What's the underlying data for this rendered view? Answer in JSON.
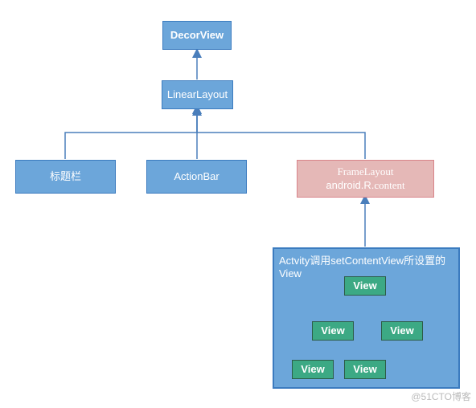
{
  "nodes": {
    "decor": "DecorView",
    "linear": "LinearLayout",
    "title_bar": "标题栏",
    "action_bar": "ActionBar",
    "frame_line1": "FrameLayout",
    "frame_line2_a": "android.R.",
    "frame_line2_b": "content"
  },
  "panel": {
    "title": "Actvity调用setContentView所设置的View"
  },
  "subtree": {
    "v1": "View",
    "v2": "View",
    "v3": "View",
    "v4": "View",
    "v5": "View"
  },
  "watermark": "@51CTO博客",
  "colors": {
    "blue_fill": "#6CA6DA",
    "blue_border": "#3B7BBF",
    "pink_fill": "#E5B8B7",
    "pink_border": "#D9848A",
    "green_fill": "#3CA984",
    "green_border": "#2D5C48",
    "line": "#4A7EBB"
  }
}
